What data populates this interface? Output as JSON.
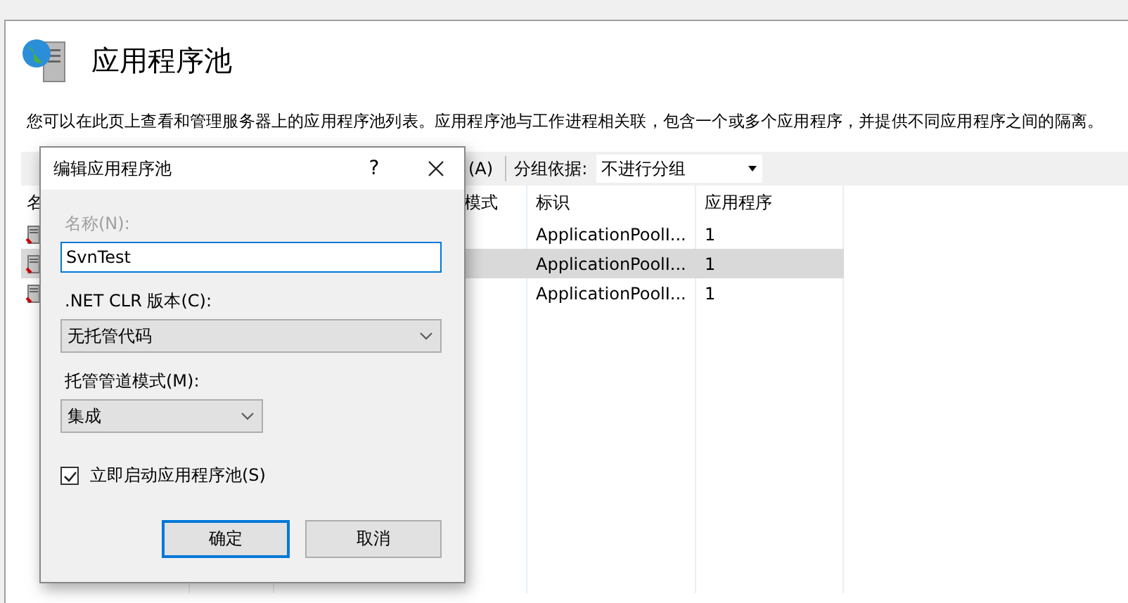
{
  "page": {
    "title": "应用程序池",
    "description": "您可以在此页上查看和管理服务器上的应用程序池列表。应用程序池与工作进程相关联，包含一个或多个应用程序，并提供不同应用程序之间的隔离。"
  },
  "toolbar": {
    "button": "(A)",
    "group_label": "分组依据:",
    "group_by": "不进行分组"
  },
  "table": {
    "columns": [
      "名",
      "模式",
      "标识",
      "应用程序"
    ],
    "rows": [
      {
        "identity": "ApplicationPoolI...",
        "applications": "1",
        "selected": false
      },
      {
        "identity": "ApplicationPoolI...",
        "applications": "1",
        "selected": true
      },
      {
        "identity": "ApplicationPoolI...",
        "applications": "1",
        "selected": false
      }
    ]
  },
  "dialog": {
    "title": "编辑应用程序池",
    "help": "?",
    "fields": [
      {
        "kind": "text",
        "label": "名称(N):",
        "disabled": true,
        "value": "SvnTest"
      },
      {
        "kind": "select",
        "label": ".NET CLR 版本(C):",
        "disabled": false,
        "value": "无托管代码",
        "wide": true
      },
      {
        "kind": "select",
        "label": "托管管道模式(M):",
        "disabled": false,
        "value": "集成",
        "wide": false
      }
    ],
    "checkbox": {
      "label": "立即启动应用程序池(S)",
      "checked": true
    },
    "buttons": [
      {
        "label": "确定",
        "default": true
      },
      {
        "label": "取消",
        "default": false
      }
    ]
  }
}
